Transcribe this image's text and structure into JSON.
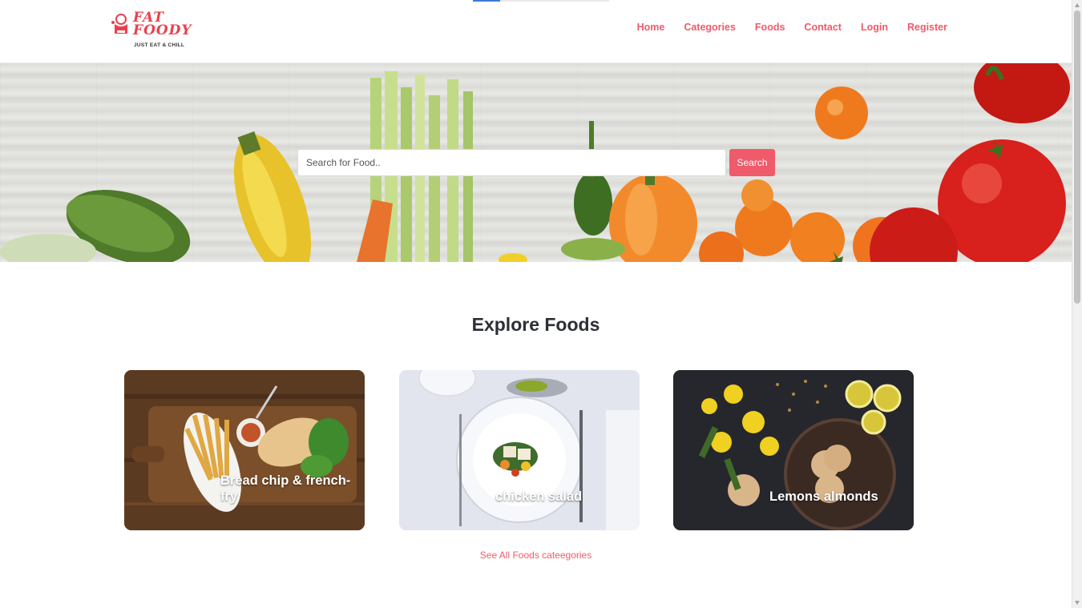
{
  "brand": {
    "name_line1": "FAT",
    "name_line2": "FOODY",
    "tagline": "JUST EAT & CHILL",
    "logo_icon": "chef-logo-icon",
    "accent_color": "#ef5b6a"
  },
  "nav": {
    "items": [
      {
        "label": "Home"
      },
      {
        "label": "Categories"
      },
      {
        "label": "Foods"
      },
      {
        "label": "Contact"
      },
      {
        "label": "Login"
      },
      {
        "label": "Register"
      }
    ]
  },
  "page_load_progress": 0.2,
  "search": {
    "placeholder": "Search for Food..",
    "value": "",
    "button_label": "Search"
  },
  "explore": {
    "title": "Explore Foods",
    "cards": [
      {
        "label": "Bread chip & french-fry"
      },
      {
        "label": "chicken salad"
      },
      {
        "label": "Lemons almonds"
      }
    ],
    "see_all_label": "See All Foods cateegories"
  }
}
